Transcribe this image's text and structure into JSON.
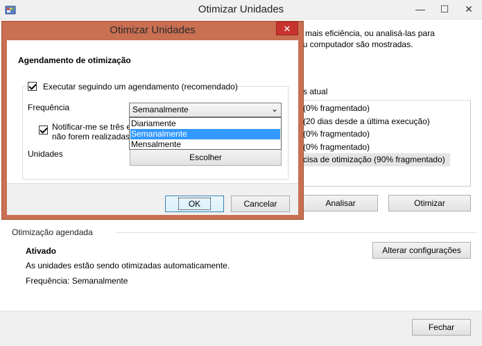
{
  "main_window": {
    "title": "Otimizar Unidades",
    "window_controls": [
      "—",
      "☐",
      "✕"
    ],
    "intro_line1": "n mais eficiência, ou analisá-las para",
    "intro_line2": "eu computador são mostradas.",
    "table": {
      "status_header": "tus atual",
      "status_rows": [
        "(0% fragmentado)",
        "(20 dias desde a última execução)",
        "(0% fragmentado)",
        "(0% fragmentado)",
        "cisa de otimização (90% fragmentado)"
      ]
    },
    "analyze_button": "Analisar",
    "optimize_button": "Otimizar",
    "scheduled_section": {
      "heading": "Otimização agendada",
      "state": "Ativado",
      "description": "As unidades estão sendo otimizadas automaticamente.",
      "frequency_text": "Frequência: Semanalmente",
      "change_settings_button": "Alterar configurações"
    },
    "close_button": "Fechar"
  },
  "dialog": {
    "title": "Otimizar Unidades",
    "section_title": "Agendamento de otimização",
    "run_on_schedule_label": "Executar seguindo um agendamento (recomendado)",
    "run_on_schedule_checked": true,
    "frequency_label": "Frequência",
    "frequency_selected": "Semanalmente",
    "frequency_options": [
      "Diariamente",
      "Semanalmente",
      "Mensalmente"
    ],
    "notify_label_line1": "Notificar-me se três e",
    "notify_label_line2": "não forem realizadas",
    "notify_checked": true,
    "drives_label": "Unidades",
    "choose_button": "Escolher",
    "ok_button": "OK",
    "cancel_button": "Cancelar"
  },
  "colors": {
    "dialog_frame": "#c96f52",
    "close_red": "#c7332d",
    "selection_blue": "#3399ff"
  }
}
